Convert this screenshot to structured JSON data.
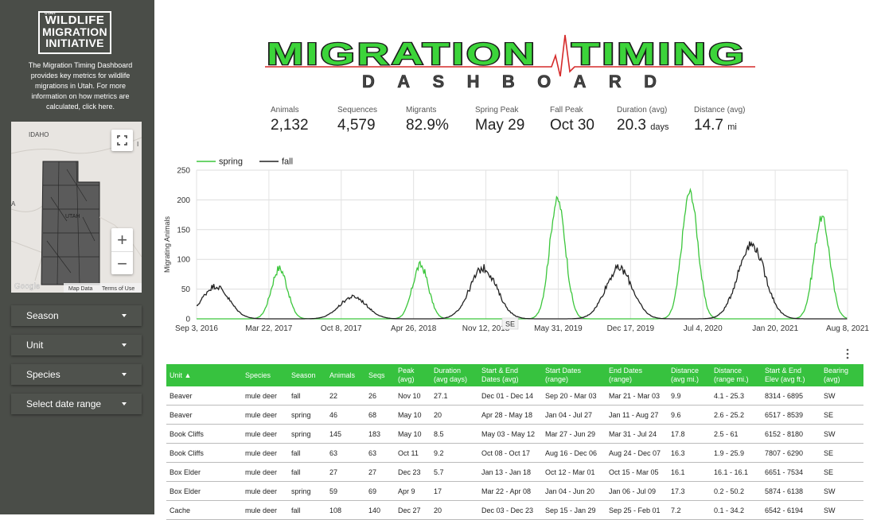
{
  "sidebar": {
    "logo": {
      "small": "UTAH",
      "line1": "WILDLIFE",
      "line2": "MIGRATION",
      "line3": "INITIATIVE"
    },
    "intro": "The Migration Timing Dashboard provides key metrics for wildlife migrations in Utah. For more information on how metrics are calculated, click here.",
    "map": {
      "label_idaho": "IDAHO",
      "label_utah": "UTAH",
      "label_a": "A",
      "label_i": "I",
      "google": "Google",
      "map_data": "Map Data",
      "terms": "Terms of Use",
      "zoom_in": "+",
      "zoom_out": "−"
    },
    "filters": [
      {
        "label": "Season"
      },
      {
        "label": "Unit"
      },
      {
        "label": "Species"
      },
      {
        "label": "Select date range"
      }
    ]
  },
  "header": {
    "title_left": "MIGRATION",
    "title_right": "TIMING",
    "subtitle": "DASHBOARD"
  },
  "kpis": [
    {
      "label": "Animals",
      "value": "2,132",
      "unit": ""
    },
    {
      "label": "Sequences",
      "value": "4,579",
      "unit": ""
    },
    {
      "label": "Migrants",
      "value": "82.9%",
      "unit": ""
    },
    {
      "label": "Spring Peak",
      "value": "May 29",
      "unit": ""
    },
    {
      "label": "Fall Peak",
      "value": "Oct 30",
      "unit": ""
    },
    {
      "label": "Duration (avg)",
      "value": "20.3",
      "unit": "days"
    },
    {
      "label": "Distance (avg)",
      "value": "14.7",
      "unit": "mi"
    }
  ],
  "chart_data": {
    "type": "line",
    "ylabel": "Migrating Animals",
    "ylim": [
      0,
      250
    ],
    "yticks": [
      0,
      50,
      100,
      150,
      200,
      250
    ],
    "xticks": [
      "Sep 3, 2016",
      "Mar 22, 2017",
      "Oct 8, 2017",
      "Apr 26, 2018",
      "Nov 12, 2018",
      "May 31, 2019",
      "Dec 17, 2019",
      "Jul 4, 2020",
      "Jan 20, 2021",
      "Aug 8, 2021"
    ],
    "grid": true,
    "legend_position": "top-left",
    "tooltip": "SE",
    "series": [
      {
        "name": "spring",
        "color": "#3cc63c",
        "peaks": [
          {
            "date": "2017-04-20",
            "value": 85
          },
          {
            "date": "2018-05-15",
            "value": 90
          },
          {
            "date": "2019-05-29",
            "value": 200
          },
          {
            "date": "2020-05-29",
            "value": 213
          },
          {
            "date": "2021-05-29",
            "value": 170
          }
        ]
      },
      {
        "name": "fall",
        "color": "#222222",
        "peaks": [
          {
            "date": "2016-10-25",
            "value": 55
          },
          {
            "date": "2017-11-10",
            "value": 37
          },
          {
            "date": "2018-11-05",
            "value": 85
          },
          {
            "date": "2019-11-15",
            "value": 85
          },
          {
            "date": "2020-11-15",
            "value": 125
          }
        ]
      }
    ]
  },
  "table": {
    "columns": [
      "Unit ▲",
      "Species",
      "Season",
      "Animals",
      "Seqs",
      "Peak (avg)",
      "Duration (avg days)",
      "Start & End Dates (avg)",
      "Start Dates (range)",
      "End Dates (range)",
      "Distance (avg mi.)",
      "Distance (range mi.)",
      "Start & End Elev (avg ft.)",
      "Bearing (avg)"
    ],
    "rows": [
      [
        "Beaver",
        "mule deer",
        "fall",
        "22",
        "26",
        "Nov 10",
        "27.1",
        "Dec 01 - Dec 14",
        "Sep 20 - Mar 03",
        "Mar 21 - Mar 03",
        "9.9",
        "4.1 - 25.3",
        "8314 - 6895",
        "SW"
      ],
      [
        "Beaver",
        "mule deer",
        "spring",
        "46",
        "68",
        "May 10",
        "20",
        "Apr 28 - May 18",
        "Jan 04 - Jul 27",
        "Jan 11 - Aug 27",
        "9.6",
        "2.6 - 25.2",
        "6517 - 8539",
        "SE"
      ],
      [
        "Book Cliffs",
        "mule deer",
        "spring",
        "145",
        "183",
        "May 10",
        "8.5",
        "May 03 - May 12",
        "Mar 27 - Jun 29",
        "Mar 31 - Jul 24",
        "17.8",
        "2.5 - 61",
        "6152 - 8180",
        "SW"
      ],
      [
        "Book Cliffs",
        "mule deer",
        "fall",
        "63",
        "63",
        "Oct 11",
        "9.2",
        "Oct 08 - Oct 17",
        "Aug 16 - Dec 06",
        "Aug 24 - Dec 07",
        "16.3",
        "1.9 - 25.9",
        "7807 - 6290",
        "SE"
      ],
      [
        "Box Elder",
        "mule deer",
        "fall",
        "27",
        "27",
        "Dec 23",
        "5.7",
        "Jan 13 - Jan 18",
        "Oct 12 - Mar 01",
        "Oct 15 - Mar 05",
        "16.1",
        "16.1 - 16.1",
        "6651 - 7534",
        "SE"
      ],
      [
        "Box Elder",
        "mule deer",
        "spring",
        "59",
        "69",
        "Apr 9",
        "17",
        "Mar 22 - Apr 08",
        "Jan 04 - Jun 20",
        "Jan 06 - Jul 09",
        "17.3",
        "0.2 - 50.2",
        "5874 - 6138",
        "SW"
      ],
      [
        "Cache",
        "mule deer",
        "fall",
        "108",
        "140",
        "Dec 27",
        "20",
        "Dec 03 - Dec 23",
        "Sep 15 - Jan 29",
        "Sep 25 - Feb 01",
        "7.2",
        "0.1 - 34.2",
        "6542 - 6194",
        "SW"
      ]
    ]
  },
  "more_icon": "vertical-dots-icon"
}
